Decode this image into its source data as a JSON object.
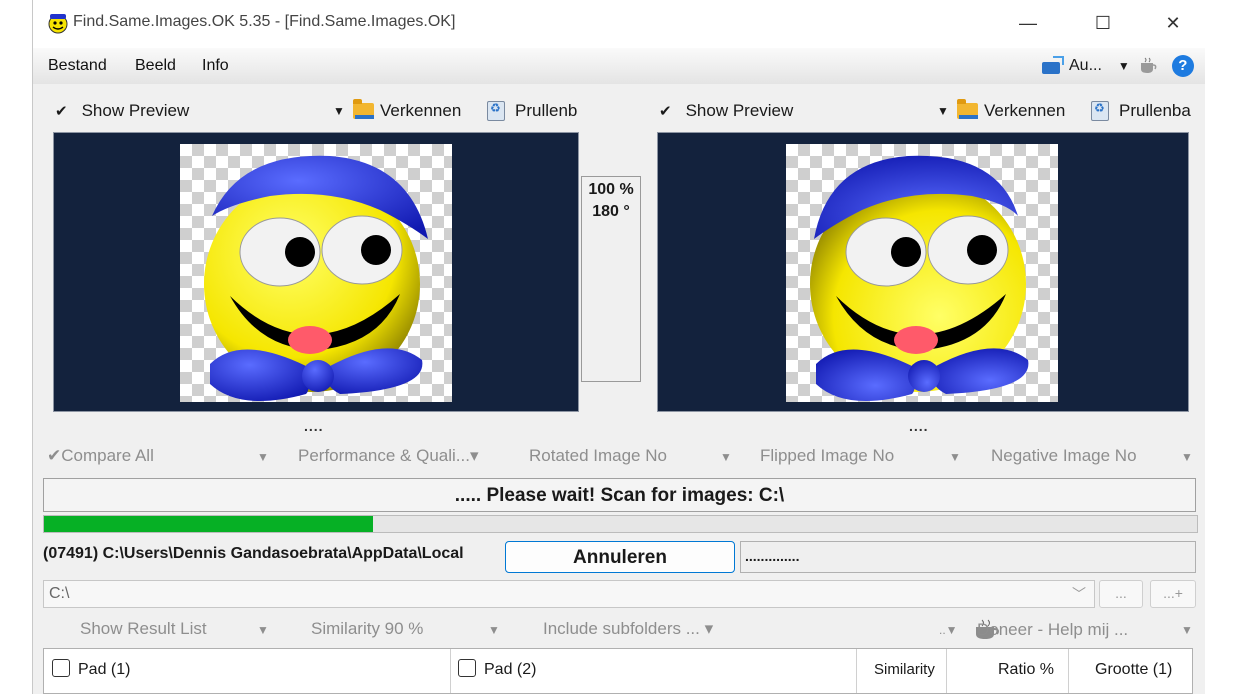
{
  "window": {
    "title": "Find.Same.Images.OK 5.35 - [Find.Same.Images.OK]",
    "controls": {
      "minimize": "—",
      "maximize": "☐",
      "close": "✕"
    }
  },
  "menu": {
    "items": [
      "Bestand",
      "Beeld",
      "Info"
    ],
    "right_label": "Au...",
    "help": "?"
  },
  "left_pane": {
    "show_preview": "Show Preview",
    "explore": "Verkennen",
    "recycle": "Prullenb"
  },
  "right_pane": {
    "show_preview": "Show Preview",
    "explore": "Verkennen",
    "recycle": "Prullenba"
  },
  "compare_info": {
    "zoom": "100 %",
    "rotation": "180 °"
  },
  "dots": "....",
  "options": {
    "compare_all": "Compare All",
    "performance": "Performance & Quali...▾",
    "rotated": "Rotated Image No",
    "flipped": "Flipped Image No",
    "negative": "Negative Image No"
  },
  "status": {
    "message": "..... Please wait! Scan for images: C:\\",
    "progress": 0.285
  },
  "scan_path": "(07491) C:\\Users\\Dennis Gandasoebrata\\AppData\\Local",
  "cancel_label": "Annuleren",
  "dot_field": "..............",
  "folder": {
    "value": "C:\\",
    "browse_label": "...",
    "add_label": "...+"
  },
  "options2": {
    "show_result": "Show Result List",
    "similarity": "Similarity 90 %",
    "subfolders": "Include subfolders ... ▾",
    "donate": "Doneer - Help mij ..."
  },
  "columns": {
    "pad1": "Pad (1)",
    "pad2": "Pad (2)",
    "similarity": "Similarity",
    "ratio": "Ratio %",
    "size": "Grootte (1)"
  },
  "icons": {
    "app": "smiley-app-icon",
    "folder": "folder-icon",
    "recycle": "recycle-bin-icon",
    "coffee": "coffee-icon",
    "help": "help-icon"
  },
  "colors": {
    "preview_bg": "#13223d",
    "progress": "#06b025",
    "accent": "#0078d4"
  }
}
